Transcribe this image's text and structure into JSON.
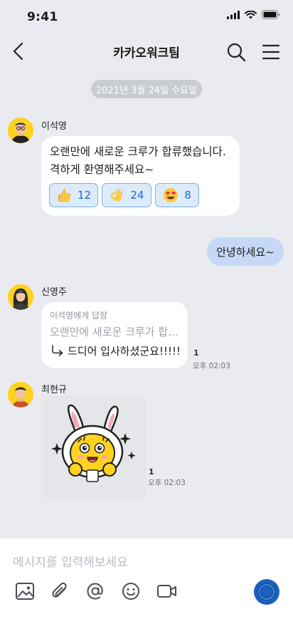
{
  "status_bar": {
    "time": "9:41"
  },
  "header": {
    "title": "카카오워크팀"
  },
  "date_divider": "2021년 3월 24일 수요일",
  "messages": [
    {
      "sender": "이석영",
      "lines": [
        "오랜만에 새로운 크루가 합류했습니다.",
        "격하게 환영해주세요~"
      ],
      "reactions": [
        {
          "icon": "thumbs-up-icon",
          "count": "12"
        },
        {
          "icon": "ok-hand-icon",
          "count": "24"
        },
        {
          "icon": "heart-eyes-icon",
          "count": "8"
        }
      ]
    },
    {
      "mine": true,
      "text": "안녕하세요~"
    },
    {
      "sender": "신영주",
      "reply_to": "이석영에게 답장",
      "quoted": "오랜만에 새로운 크루가 합…",
      "text": "드디어 입사하셨군요!!!!!",
      "unread": "1",
      "time": "오후 02:03"
    },
    {
      "sender": "최현규",
      "sticker": "rabbit-sticker",
      "unread": "1",
      "time": "오후 02:03"
    }
  ],
  "composer": {
    "placeholder": "메시지를 입력해보세요",
    "tools": [
      "image-icon",
      "paperclip-icon",
      "mention-icon",
      "emoji-icon",
      "video-icon"
    ]
  },
  "colors": {
    "background": "#e9ebf0",
    "my_bubble": "#c5d9f7",
    "reaction_bg": "#dcebfa",
    "reaction_border": "#7ab2e8",
    "send_button": "#1a5fbf"
  }
}
